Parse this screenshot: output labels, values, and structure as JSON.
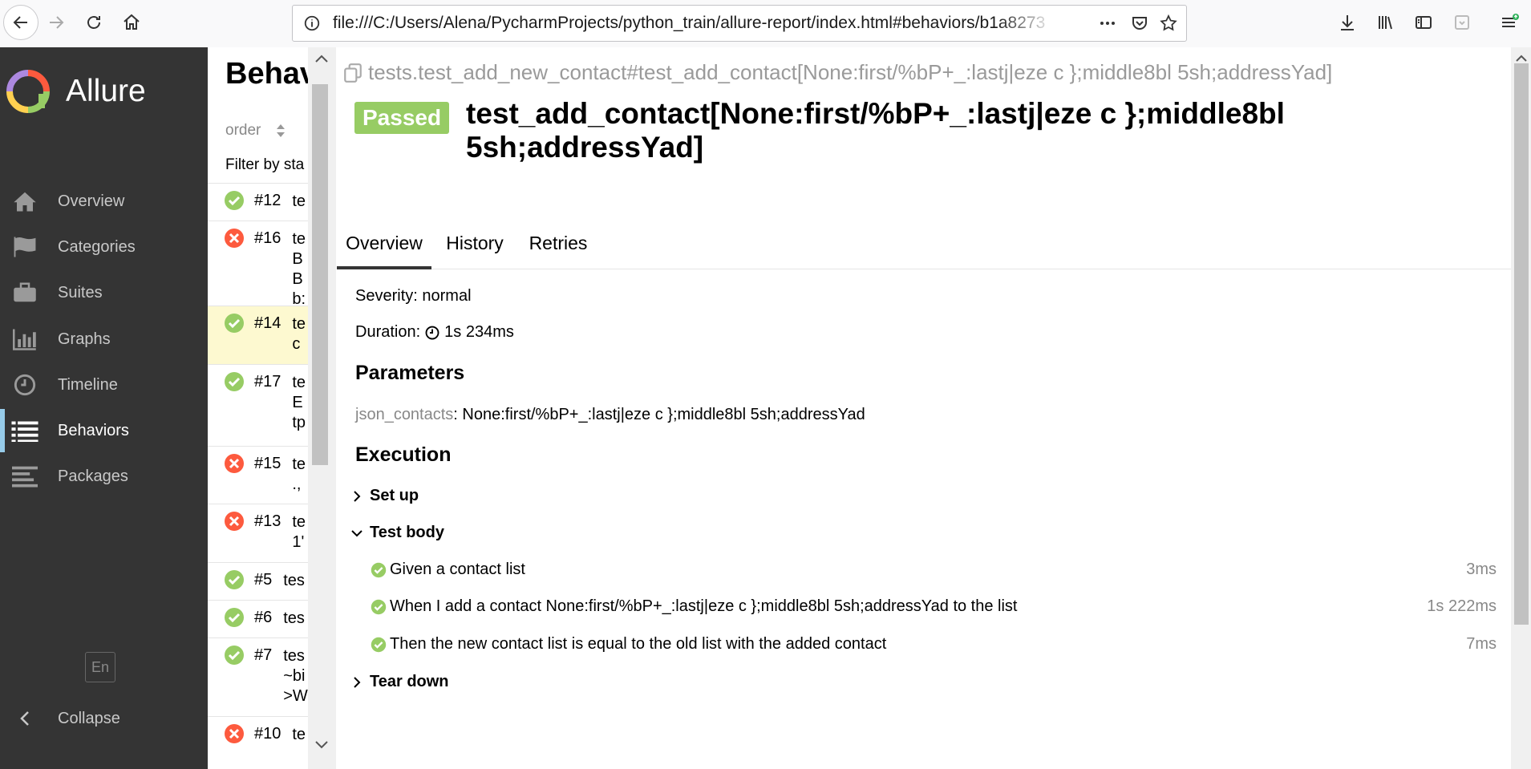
{
  "browser": {
    "url": "file:///C:/Users/Alena/PycharmProjects/python_train/allure-report/index.html#behaviors/b1a8273"
  },
  "sidebar": {
    "brand": "Allure",
    "items": [
      {
        "label": "Overview",
        "icon": "home-icon"
      },
      {
        "label": "Categories",
        "icon": "flag-icon"
      },
      {
        "label": "Suites",
        "icon": "briefcase-icon"
      },
      {
        "label": "Graphs",
        "icon": "bar-chart-icon"
      },
      {
        "label": "Timeline",
        "icon": "clock-icon"
      },
      {
        "label": "Behaviors",
        "icon": "list-icon",
        "active": true
      },
      {
        "label": "Packages",
        "icon": "align-left-icon"
      }
    ],
    "language": "En",
    "collapse": "Collapse"
  },
  "tree": {
    "title": "Behav",
    "order_label": "order",
    "filter_label": "Filter by sta",
    "rows": [
      {
        "num": "#12",
        "status": "passed",
        "text": "te"
      },
      {
        "num": "#16",
        "status": "failed",
        "text": "te\nB\nB\nb:"
      },
      {
        "num": "#14",
        "status": "passed",
        "text": "te\nc",
        "selected": true
      },
      {
        "num": "#17",
        "status": "passed",
        "text": "te\nE\ntp"
      },
      {
        "num": "#15",
        "status": "failed",
        "text": "te\n.,"
      },
      {
        "num": "#13",
        "status": "failed",
        "text": "te\n1'"
      },
      {
        "num": "#5",
        "status": "passed",
        "text": "tes"
      },
      {
        "num": "#6",
        "status": "passed",
        "text": "tes"
      },
      {
        "num": "#7",
        "status": "passed",
        "text": "tes\n~bi\n>W"
      },
      {
        "num": "#10",
        "status": "failed",
        "text": "te"
      }
    ]
  },
  "main": {
    "breadcrumb": "tests.test_add_new_contact#test_add_contact[None:first/%bP+_:lastj|eze c };middle8bl 5sh;addressYad]",
    "status": "Passed",
    "title": "test_add_contact[None:first/%bP+_:lastj|eze c };middle8bl 5sh;addressYad]",
    "tabs": [
      "Overview",
      "History",
      "Retries"
    ],
    "severity_label": "Severity:",
    "severity_value": "normal",
    "duration_label": "Duration:",
    "duration_value": "1s 234ms",
    "parameters_heading": "Parameters",
    "param_key": "json_contacts",
    "param_value": ": None:first/%bP+_:lastj|eze c };middle8bl 5sh;addressYad",
    "execution_heading": "Execution",
    "setup_label": "Set up",
    "body_label": "Test body",
    "teardown_label": "Tear down",
    "steps": [
      {
        "text": "Given a contact list",
        "duration": "3ms"
      },
      {
        "text": "When I add a contact None:first/%bP+_:lastj|eze c };middle8bl 5sh;addressYad to the list",
        "duration": "1s 222ms"
      },
      {
        "text": "Then the new contact list is equal to the old list with the added contact",
        "duration": "7ms"
      }
    ]
  },
  "colors": {
    "passed": "#97cc64",
    "failed": "#fd5a3e",
    "sidebar": "#343434",
    "active_accent": "#97cbe9"
  }
}
